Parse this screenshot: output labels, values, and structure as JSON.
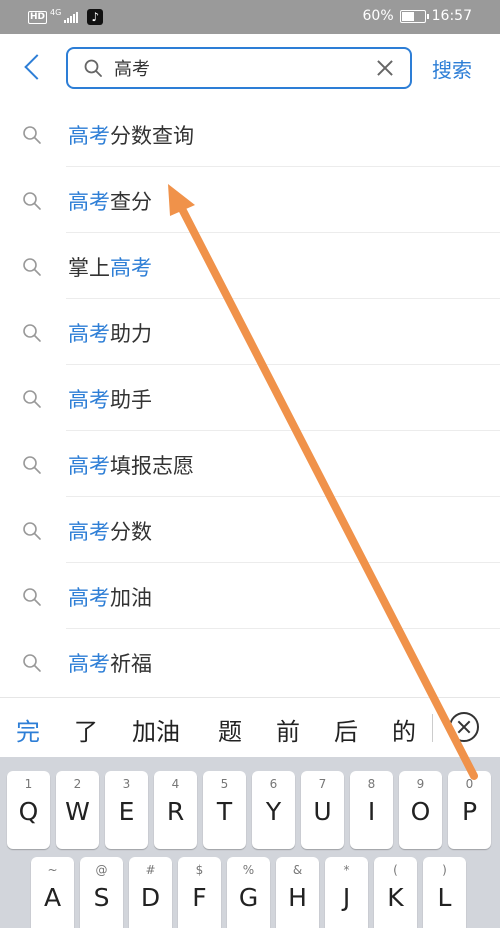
{
  "status_bar": {
    "hd": "HD",
    "network": "4G",
    "battery_text": "60%",
    "battery_level": 0.6,
    "time": "16:57"
  },
  "search": {
    "query": "高考",
    "submit_label": "搜索"
  },
  "suggestions": [
    {
      "highlight": "高考",
      "rest": "分数查询",
      "prefix": ""
    },
    {
      "highlight": "高考",
      "rest": "查分",
      "prefix": ""
    },
    {
      "prefix": "掌上",
      "highlight": "高考",
      "rest": ""
    },
    {
      "highlight": "高考",
      "rest": "助力",
      "prefix": ""
    },
    {
      "highlight": "高考",
      "rest": "助手",
      "prefix": ""
    },
    {
      "highlight": "高考",
      "rest": "填报志愿",
      "prefix": ""
    },
    {
      "highlight": "高考",
      "rest": "分数",
      "prefix": ""
    },
    {
      "highlight": "高考",
      "rest": "加油",
      "prefix": ""
    },
    {
      "highlight": "高考",
      "rest": "祈福",
      "prefix": ""
    }
  ],
  "candidates": [
    "完",
    "了",
    "加油",
    "题",
    "前",
    "后",
    "的"
  ],
  "keyboard": {
    "row1": [
      {
        "num": "1",
        "key": "Q"
      },
      {
        "num": "2",
        "key": "W"
      },
      {
        "num": "3",
        "key": "E"
      },
      {
        "num": "4",
        "key": "R"
      },
      {
        "num": "5",
        "key": "T"
      },
      {
        "num": "6",
        "key": "Y"
      },
      {
        "num": "7",
        "key": "U"
      },
      {
        "num": "8",
        "key": "I"
      },
      {
        "num": "9",
        "key": "O"
      },
      {
        "num": "0",
        "key": "P"
      }
    ],
    "row2": [
      {
        "num": "~",
        "key": "A"
      },
      {
        "num": "@",
        "key": "S"
      },
      {
        "num": "#",
        "key": "D"
      },
      {
        "num": "$",
        "key": "F"
      },
      {
        "num": "%",
        "key": "G"
      },
      {
        "num": "&",
        "key": "H"
      },
      {
        "num": "*",
        "key": "J"
      },
      {
        "num": "(",
        "key": "K"
      },
      {
        "num": ")",
        "key": "L"
      }
    ]
  },
  "colors": {
    "accent": "#2d7ed6",
    "annotation_arrow": "#f0924a",
    "status_bar": "#9a9a9a",
    "keyboard_bg": "#d2d5db"
  }
}
